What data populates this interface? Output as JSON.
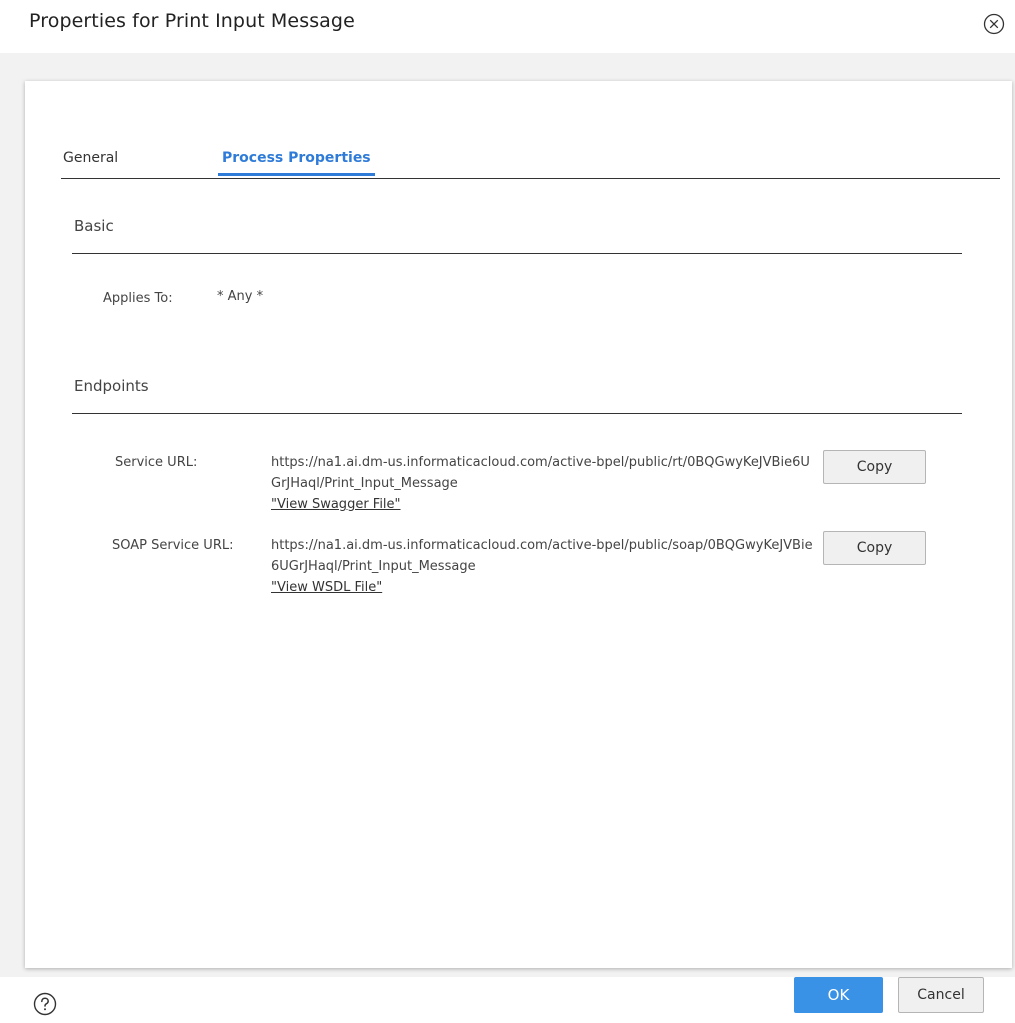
{
  "dialog": {
    "title": "Properties for Print Input Message",
    "close_icon": "close-circle-icon",
    "help_icon": "help-circle-icon"
  },
  "tabs": [
    {
      "label": "General",
      "active": false
    },
    {
      "label": "Process Properties",
      "active": true
    }
  ],
  "basic": {
    "title": "Basic",
    "applies_to_label": "Applies To:",
    "applies_to_value": "* Any *"
  },
  "endpoints": {
    "title": "Endpoints",
    "service": {
      "label": "Service URL:",
      "url": "https://na1.ai.dm-us.informaticacloud.com/active-bpel/public/rt/0BQGwyKeJVBie6UGrJHaql/Print_Input_Message",
      "link": "\"View Swagger File\"",
      "copy_label": "Copy"
    },
    "soap": {
      "label": "SOAP Service URL:",
      "url": "https://na1.ai.dm-us.informaticacloud.com/active-bpel/public/soap/0BQGwyKeJVBie6UGrJHaql/Print_Input_Message",
      "link": "\"View WSDL File\"",
      "copy_label": "Copy"
    }
  },
  "footer": {
    "ok_label": "OK",
    "cancel_label": "Cancel"
  },
  "colors": {
    "accent": "#2f7bd8",
    "ok_button": "#3a92e6",
    "body_background": "#f2f2f2"
  }
}
